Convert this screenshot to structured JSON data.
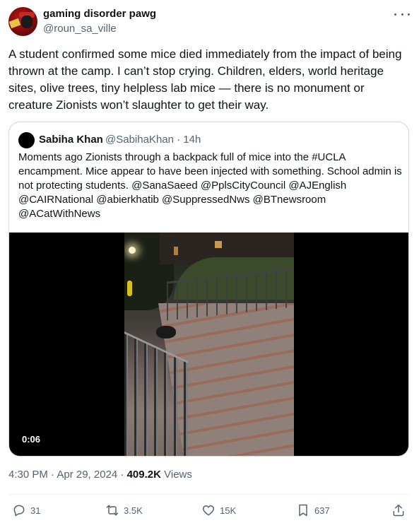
{
  "author": {
    "display_name": "gaming disorder pawg",
    "handle": "@roun_sa_ville"
  },
  "post": {
    "text": "A student confirmed some mice died immediately from the impact of being thrown at the camp. I can’t stop crying. Children, elders, world heritage sites, olive trees, tiny helpless lab mice — there is no monument or creature Zionists won’t slaughter to get their way."
  },
  "quote": {
    "display_name": "Sabiha Khan",
    "meta": "@SabihaKhan · 14h",
    "text": "Moments ago Zionists through a backpack full of mice into the #UCLA encampment. Mice appear to have been injected with something. School admin  is not protecting students. @SanaSaeed @PplsCityCouncil @AJEnglish @CAIRNational @abierkhatib @SuppressedNws @BTnewsroom @ACatWithNews",
    "video_duration": "0:06"
  },
  "timestamp": {
    "time_date": "4:30 PM · Apr 29, 2024 · ",
    "views_count": "409.2K",
    "views_label": " Views"
  },
  "actions": {
    "replies": "31",
    "reposts": "3.5K",
    "likes": "15K",
    "bookmarks": "637"
  },
  "icons": [
    "more-icon",
    "reply-icon",
    "retweet-icon",
    "like-icon",
    "bookmark-icon",
    "share-icon"
  ],
  "colors": {
    "text_primary": "#0f1419",
    "text_secondary": "#536471",
    "border": "#cfd9de"
  }
}
